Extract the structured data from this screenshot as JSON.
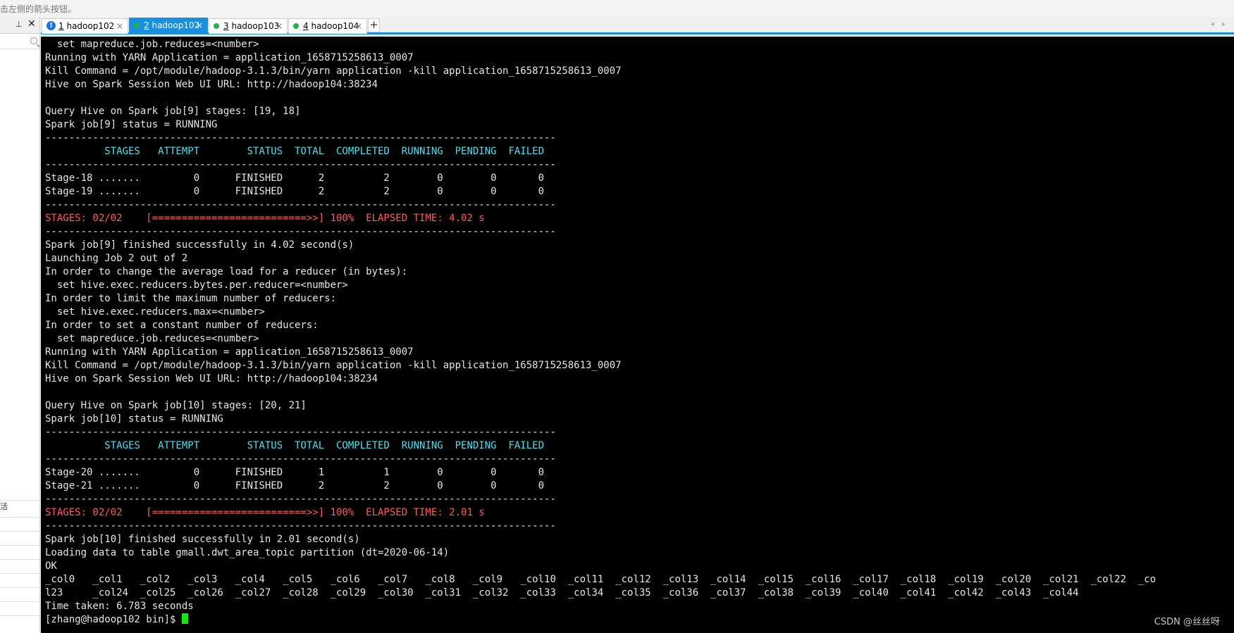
{
  "topbar": {
    "hint": "击左侧的箭头按钮。"
  },
  "left_panel": {
    "pin_icon": "pin-icon",
    "close_glyph": "✕",
    "char": "活"
  },
  "tabs": [
    {
      "num": "1",
      "name": "hadoop102",
      "status": "info",
      "active": false
    },
    {
      "num": "2",
      "name": "hadoop102",
      "status": "connected",
      "active": true
    },
    {
      "num": "3",
      "name": "hadoop103",
      "status": "connected",
      "active": false
    },
    {
      "num": "4",
      "name": "hadoop104",
      "status": "connected",
      "active": false
    }
  ],
  "tab_close_glyph": "×",
  "add_tab_glyph": "+",
  "nav_arrows": "◂ ▸",
  "colors": {
    "accent": "#1a8fe0",
    "connected": "#22b14c",
    "cyan": "#3fe4f4",
    "red": "#ff5b5b",
    "cursor": "#11e611"
  },
  "terminal": {
    "lines": [
      {
        "t": "  set mapreduce.job.reduces=<number>"
      },
      {
        "t": "Running with YARN Application = application_1658715258613_0007"
      },
      {
        "t": "Kill Command = /opt/module/hadoop-3.1.3/bin/yarn application -kill application_1658715258613_0007"
      },
      {
        "t": "Hive on Spark Session Web UI URL: http://hadoop104:38234"
      },
      {
        "t": ""
      },
      {
        "t": "Query Hive on Spark job[9] stages: [19, 18]"
      },
      {
        "t": "Spark job[9] status = RUNNING"
      },
      {
        "t": "--------------------------------------------------------------------------------------"
      },
      {
        "t": "          STAGES   ATTEMPT        STATUS  TOTAL  COMPLETED  RUNNING  PENDING  FAILED",
        "c": "cyan"
      },
      {
        "t": "--------------------------------------------------------------------------------------"
      },
      {
        "t": "Stage-18 .......         0      FINISHED      2          2        0        0       0"
      },
      {
        "t": "Stage-19 .......         0      FINISHED      2          2        0        0       0"
      },
      {
        "t": "--------------------------------------------------------------------------------------"
      },
      {
        "t": "STAGES: 02/02    [==========================>>] 100%  ELAPSED TIME: 4.02 s",
        "c": "red"
      },
      {
        "t": "--------------------------------------------------------------------------------------"
      },
      {
        "t": "Spark job[9] finished successfully in 4.02 second(s)"
      },
      {
        "t": "Launching Job 2 out of 2"
      },
      {
        "t": "In order to change the average load for a reducer (in bytes):"
      },
      {
        "t": "  set hive.exec.reducers.bytes.per.reducer=<number>"
      },
      {
        "t": "In order to limit the maximum number of reducers:"
      },
      {
        "t": "  set hive.exec.reducers.max=<number>"
      },
      {
        "t": "In order to set a constant number of reducers:"
      },
      {
        "t": "  set mapreduce.job.reduces=<number>"
      },
      {
        "t": "Running with YARN Application = application_1658715258613_0007"
      },
      {
        "t": "Kill Command = /opt/module/hadoop-3.1.3/bin/yarn application -kill application_1658715258613_0007"
      },
      {
        "t": "Hive on Spark Session Web UI URL: http://hadoop104:38234"
      },
      {
        "t": ""
      },
      {
        "t": "Query Hive on Spark job[10] stages: [20, 21]"
      },
      {
        "t": "Spark job[10] status = RUNNING"
      },
      {
        "t": "--------------------------------------------------------------------------------------"
      },
      {
        "t": "          STAGES   ATTEMPT        STATUS  TOTAL  COMPLETED  RUNNING  PENDING  FAILED",
        "c": "cyan"
      },
      {
        "t": "--------------------------------------------------------------------------------------"
      },
      {
        "t": "Stage-20 .......         0      FINISHED      1          1        0        0       0"
      },
      {
        "t": "Stage-21 .......         0      FINISHED      2          2        0        0       0"
      },
      {
        "t": "--------------------------------------------------------------------------------------"
      },
      {
        "t": "STAGES: 02/02    [==========================>>] 100%  ELAPSED TIME: 2.01 s",
        "c": "red"
      },
      {
        "t": "--------------------------------------------------------------------------------------"
      },
      {
        "t": "Spark job[10] finished successfully in 2.01 second(s)"
      },
      {
        "t": "Loading data to table gmall.dwt_area_topic partition (dt=2020-06-14)"
      },
      {
        "t": "OK"
      },
      {
        "t": "_col0   _col1   _col2   _col3   _col4   _col5   _col6   _col7   _col8   _col9   _col10  _col11  _col12  _col13  _col14  _col15  _col16  _col17  _col18  _col19  _col20  _col21  _col22  _co"
      },
      {
        "t": "l23     _col24  _col25  _col26  _col27  _col28  _col29  _col30  _col31  _col32  _col33  _col34  _col35  _col36  _col37  _col38  _col39  _col40  _col41  _col42  _col43  _col44"
      },
      {
        "t": "Time taken: 6.783 seconds"
      }
    ],
    "prompt": "[zhang@hadoop102 bin]$ "
  },
  "watermark": "CSDN @丝丝呀"
}
